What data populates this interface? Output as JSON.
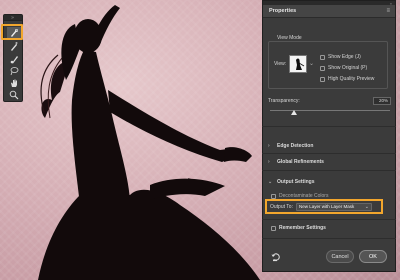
{
  "panel": {
    "title": "Properties",
    "view_mode": {
      "legend": "View Mode",
      "view_label": "View:",
      "options": [
        {
          "label": "Show Edge (J)",
          "checked": false
        },
        {
          "label": "Show Original (P)",
          "checked": false
        },
        {
          "label": "High Quality Preview",
          "checked": false
        }
      ]
    },
    "transparency": {
      "label": "Transparency:",
      "value": "20%",
      "level": 0.2
    },
    "sections": [
      {
        "label": "Edge Detection",
        "expanded": false
      },
      {
        "label": "Global Refinements",
        "expanded": false
      },
      {
        "label": "Output Settings",
        "expanded": true
      }
    ],
    "output": {
      "decontaminate_label": "Decontaminate Colors",
      "output_to_label": "Output To:",
      "output_to_value": "New Layer with Layer Mask"
    },
    "remember_label": "Remember Settings",
    "buttons": {
      "cancel": "Cancel",
      "ok": "OK"
    }
  },
  "toolbar": {
    "tools": [
      "quick-selection-icon",
      "refine-edge-brush-icon",
      "brush-icon",
      "lasso-icon",
      "hand-icon",
      "zoom-icon"
    ],
    "active_tool": "quick-selection-icon"
  },
  "colors": {
    "highlight": "#f2a62d",
    "panel_bg": "#3b3b3b",
    "checkbox_blue": "#4c84d6"
  }
}
